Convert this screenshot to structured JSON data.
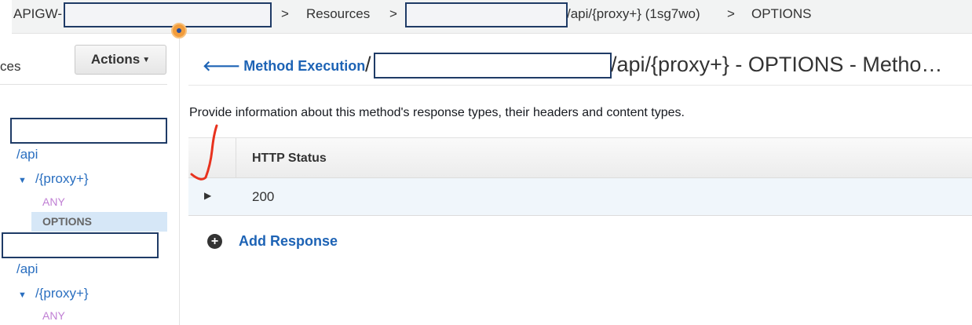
{
  "breadcrumb": {
    "api_prefix": "APIGW-",
    "sep1": ">",
    "resources": "Resources",
    "sep2": ">",
    "path_suffix": "/api/{proxy+} (1sg7wo)",
    "sep3": ">",
    "method": "OPTIONS"
  },
  "sidebar": {
    "top_label": "ces",
    "actions_label": "Actions",
    "tree": [
      {
        "label": "/api"
      },
      {
        "label": "/{proxy+}"
      },
      {
        "label": "ANY"
      },
      {
        "label": "OPTIONS",
        "selected": true
      },
      {
        "label": "/api"
      },
      {
        "label": "/{proxy+}"
      },
      {
        "label": "ANY"
      }
    ]
  },
  "main": {
    "back_label": "Method Execution",
    "title_slash": "/",
    "title": "/api/{proxy+} - OPTIONS - Metho…",
    "description": "Provide information about this method's response types, their headers and content types.",
    "table": {
      "header": "HTTP Status",
      "rows": [
        {
          "status": "200"
        }
      ]
    },
    "add_response_label": "Add Response"
  },
  "colors": {
    "link": "#1d63b5",
    "selected_bg": "#d6e7f7",
    "method_color": "#c07fd4",
    "annotation": "#e8321e"
  }
}
